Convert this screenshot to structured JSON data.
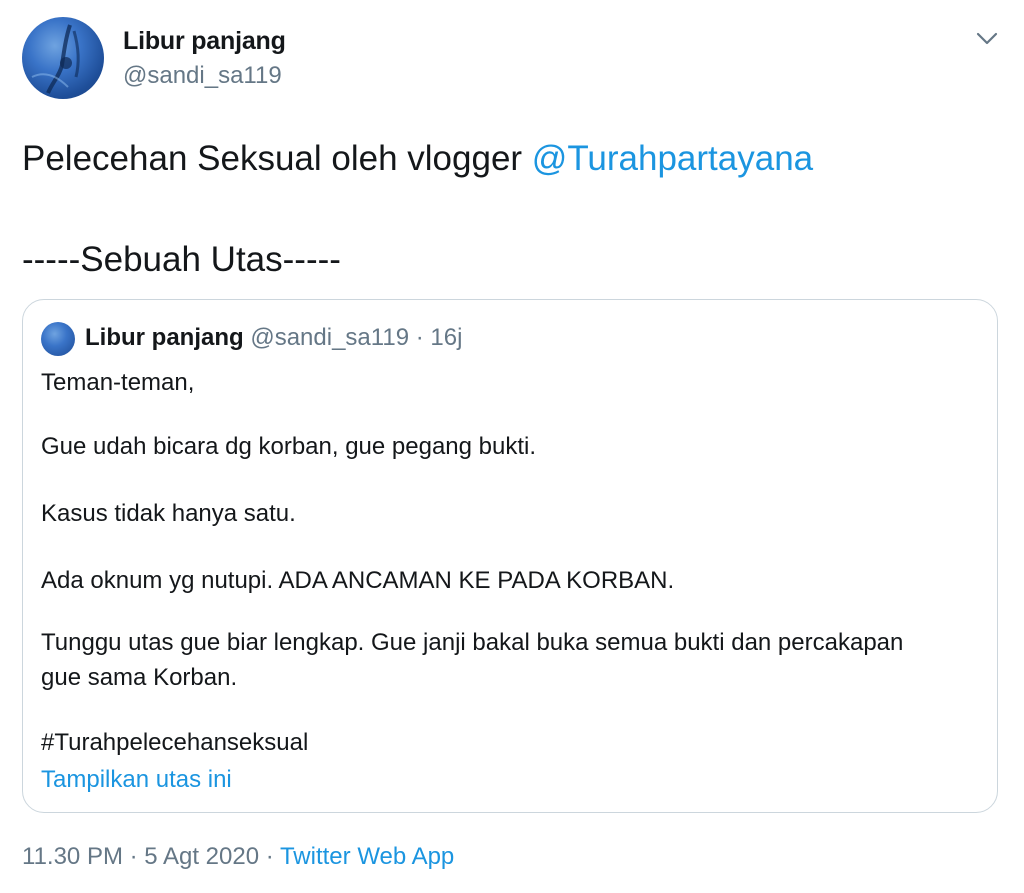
{
  "author": {
    "name": "Libur panjang",
    "handle": "@sandi_sa119"
  },
  "tweet": {
    "text_prefix": "Pelecehan Seksual oleh vlogger ",
    "mention": "@Turahpartayana",
    "line2": "-----Sebuah Utas-----"
  },
  "quoted_tweet": {
    "name": "Libur panjang",
    "handle": "@sandi_sa119",
    "separator": " · ",
    "time": "16j",
    "lines": [
      "Teman-teman,",
      "Gue udah  bicara dg korban, gue pegang bukti.",
      "Kasus tidak hanya satu.",
      "Ada oknum yg nutupi. ADA ANCAMAN KE PADA KORBAN.",
      "Tunggu utas gue biar lengkap. Gue janji bakal buka semua bukti dan percakapan",
      "gue sama Korban.",
      "#Turahpelecehanseksual"
    ],
    "show_thread": "Tampilkan utas ini"
  },
  "footer": {
    "time": "11.30 PM",
    "sep1": " · ",
    "date": "5 Agt 2020",
    "sep2": " · ",
    "source": "Twitter Web App"
  },
  "icons": {
    "menu": "chevron-down-icon"
  },
  "colors": {
    "link": "#1b95e0",
    "secondary": "#657786",
    "border": "#ccd6dd"
  }
}
